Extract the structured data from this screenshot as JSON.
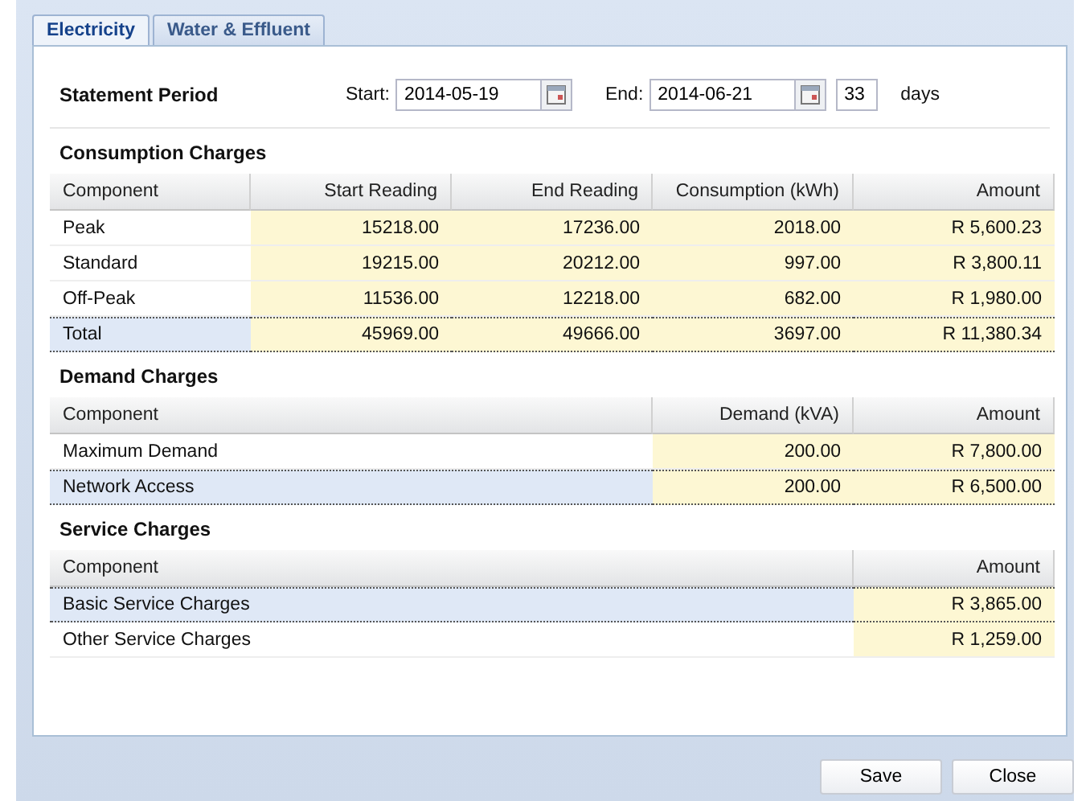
{
  "tabs": [
    {
      "label": "Electricity",
      "selected": true
    },
    {
      "label": "Water & Effluent",
      "selected": false
    }
  ],
  "statement_period": {
    "title": "Statement Period",
    "start_label": "Start:",
    "start_value": "2014-05-19",
    "end_label": "End:",
    "end_value": "2014-06-21",
    "days_value": "33",
    "days_label": "days"
  },
  "sections": [
    {
      "title": "Consumption Charges",
      "columns": [
        {
          "label": "Component"
        },
        {
          "label": "Start Reading"
        },
        {
          "label": "End Reading"
        },
        {
          "label": "Consumption (kWh)"
        },
        {
          "label": "Amount"
        }
      ],
      "rows": [
        {
          "cells": [
            "Peak",
            "15218.00",
            "17236.00",
            "2018.00",
            "R 5,600.23"
          ],
          "selected": false
        },
        {
          "cells": [
            "Standard",
            "19215.00",
            "20212.00",
            "997.00",
            "R 3,800.11"
          ],
          "selected": false
        },
        {
          "cells": [
            "Off-Peak",
            "11536.00",
            "12218.00",
            "682.00",
            "R 1,980.00"
          ],
          "selected": false
        },
        {
          "cells": [
            "Total",
            "45969.00",
            "49666.00",
            "3697.00",
            "R 11,380.34"
          ],
          "selected": true
        }
      ]
    },
    {
      "title": "Demand Charges",
      "columns": [
        {
          "label": "Component"
        },
        {
          "label": "Demand (kVA)"
        },
        {
          "label": "Amount"
        }
      ],
      "rows": [
        {
          "cells": [
            "Maximum Demand",
            "200.00",
            "R 7,800.00"
          ],
          "selected": false
        },
        {
          "cells": [
            "Network Access",
            "200.00",
            "R 6,500.00"
          ],
          "selected": true
        }
      ]
    },
    {
      "title": "Service Charges",
      "columns": [
        {
          "label": "Component"
        },
        {
          "label": "Amount"
        }
      ],
      "rows": [
        {
          "cells": [
            "Basic Service Charges",
            "R 3,865.00"
          ],
          "selected": true
        },
        {
          "cells": [
            "Other Service Charges",
            "R 1,259.00"
          ],
          "selected": false
        }
      ]
    }
  ],
  "buttons": [
    "Save",
    "Close"
  ]
}
